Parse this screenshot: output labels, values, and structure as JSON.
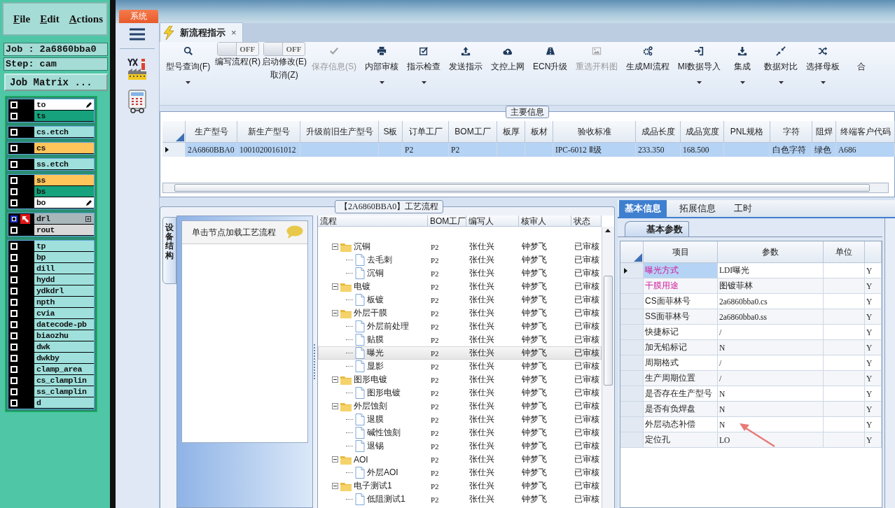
{
  "cam": {
    "menu": [
      "File",
      "Edit",
      "Actions"
    ],
    "job": "Job : 2a6860bba0",
    "step": "Step: cam",
    "matrix_button": "Job Matrix ...",
    "layer_groups": [
      {
        "layers": [
          {
            "name": "to",
            "color": "#ffffff",
            "work_layer": false,
            "pen_mark": true,
            "expandable": false
          },
          {
            "name": "ts",
            "color": "#16a27c",
            "work_layer": false,
            "pen_mark": false,
            "expandable": false
          }
        ]
      },
      {
        "layers": [
          {
            "name": "cs.etch",
            "color": "#9fe0dc",
            "work_layer": false,
            "pen_mark": false,
            "expandable": false
          }
        ]
      },
      {
        "layers": [
          {
            "name": "cs",
            "color": "#ffc45a",
            "work_layer": false,
            "pen_mark": false,
            "expandable": false
          }
        ]
      },
      {
        "layers": [
          {
            "name": "ss.etch",
            "color": "#9fe0dc",
            "work_layer": false,
            "pen_mark": false,
            "expandable": false
          }
        ]
      },
      {
        "layers": [
          {
            "name": "ss",
            "color": "#ffc45a",
            "work_layer": false,
            "pen_mark": false,
            "expandable": false
          },
          {
            "name": "bs",
            "color": "#16a27c",
            "work_layer": false,
            "pen_mark": false,
            "expandable": false
          },
          {
            "name": "bo",
            "color": "#ffffff",
            "work_layer": false,
            "pen_mark": true,
            "expandable": false
          }
        ]
      },
      {
        "layers": [
          {
            "name": "drl",
            "color": "#a9b6ba",
            "work_layer": true,
            "pen_mark": false,
            "expandable": true
          },
          {
            "name": "rout",
            "color": "#d9d9d9",
            "work_layer": false,
            "pen_mark": false,
            "expandable": false
          }
        ]
      },
      {
        "layers": [
          {
            "name": "tp",
            "color": "#9fe0dc",
            "work_layer": false,
            "pen_mark": false,
            "expandable": false
          },
          {
            "name": "bp",
            "color": "#9fe0dc",
            "work_layer": false,
            "pen_mark": false,
            "expandable": false
          },
          {
            "name": "dill",
            "color": "#9fe0dc",
            "work_layer": false,
            "pen_mark": false,
            "expandable": false
          },
          {
            "name": "hydd",
            "color": "#9fe0dc",
            "work_layer": false,
            "pen_mark": false,
            "expandable": false
          },
          {
            "name": "ydkdrl",
            "color": "#9fe0dc",
            "work_layer": false,
            "pen_mark": false,
            "expandable": false
          },
          {
            "name": "npth",
            "color": "#9fe0dc",
            "work_layer": false,
            "pen_mark": false,
            "expandable": false
          },
          {
            "name": "cvia",
            "color": "#9fe0dc",
            "work_layer": false,
            "pen_mark": false,
            "expandable": false
          },
          {
            "name": "datecode-pb",
            "color": "#9fe0dc",
            "work_layer": false,
            "pen_mark": false,
            "expandable": false
          },
          {
            "name": "biaozhu",
            "color": "#9fe0dc",
            "work_layer": false,
            "pen_mark": false,
            "expandable": false
          },
          {
            "name": "dwk",
            "color": "#9fe0dc",
            "work_layer": false,
            "pen_mark": false,
            "expandable": false
          },
          {
            "name": "dwkby",
            "color": "#9fe0dc",
            "work_layer": false,
            "pen_mark": false,
            "expandable": false
          },
          {
            "name": "clamp_area",
            "color": "#9fe0dc",
            "work_layer": false,
            "pen_mark": false,
            "expandable": false
          },
          {
            "name": "cs_clamplin",
            "color": "#9fe0dc",
            "work_layer": false,
            "pen_mark": false,
            "expandable": false
          },
          {
            "name": "ss_clamplin",
            "color": "#9fe0dc",
            "work_layer": false,
            "pen_mark": false,
            "expandable": false
          },
          {
            "name": "d",
            "color": "#9fe0dc",
            "work_layer": false,
            "pen_mark": false,
            "expandable": false
          }
        ]
      }
    ]
  },
  "app": {
    "system_tab": "系统",
    "doc_tab": {
      "title": "新流程指示",
      "close": "×",
      "selected": true
    },
    "toolbar": [
      {
        "kind": "button",
        "label": "型号查询(F)",
        "disabled": false,
        "dropdown": true
      },
      {
        "kind": "toggle",
        "label": "编写流程(R)",
        "state": "OFF",
        "on": false
      },
      {
        "kind": "toggle",
        "label": "启动修改(E)",
        "sublabel": "取消(Z)",
        "state": "OFF",
        "on": false
      },
      {
        "kind": "button",
        "label": "保存信息(S)",
        "disabled": true,
        "dropdown": false
      },
      {
        "kind": "button",
        "label": "内部审核",
        "disabled": false,
        "dropdown": true
      },
      {
        "kind": "button",
        "label": "指示检查",
        "disabled": false,
        "dropdown": true
      },
      {
        "kind": "button",
        "label": "发送指示",
        "disabled": false,
        "dropdown": false
      },
      {
        "kind": "button",
        "label": "文控上网",
        "disabled": false,
        "dropdown": false
      },
      {
        "kind": "button",
        "label": "ECN升级",
        "disabled": false,
        "dropdown": false
      },
      {
        "kind": "button",
        "label": "重选开料图",
        "disabled": true,
        "dropdown": false
      },
      {
        "kind": "button",
        "label": "生成MI流程",
        "disabled": false,
        "dropdown": false
      },
      {
        "kind": "button",
        "label": "MI数据导入",
        "disabled": false,
        "dropdown": true
      },
      {
        "kind": "button",
        "label": "集成",
        "disabled": false,
        "dropdown": true
      },
      {
        "kind": "button",
        "label": "数据对比",
        "disabled": false,
        "dropdown": true
      },
      {
        "kind": "button",
        "label": "选择母板",
        "disabled": false,
        "dropdown": true
      },
      {
        "kind": "button",
        "label": "合",
        "disabled": false,
        "dropdown": false
      }
    ],
    "main_info": {
      "title": "主要信息",
      "columns": [
        "生产型号",
        "新生产型号",
        "升级前旧生产型号",
        "S板",
        "订单工厂",
        "BOM工厂",
        "板厚",
        "板材",
        "验收标准",
        "成品长度",
        "成品宽度",
        "PNL规格",
        "字符",
        "阻焊",
        "终端客户代码"
      ],
      "rows": [
        {
          "selected": true,
          "cells": [
            "2A6860BBA0",
            "10010200161012",
            null,
            null,
            "P2",
            "P2",
            null,
            null,
            "IPC-6012 Ⅱ级",
            "233.350",
            "168.500",
            null,
            "白色字符",
            "绿色",
            "A686"
          ]
        }
      ]
    },
    "process": {
      "title": "【2A6860BBA0】工艺流程",
      "side_tab": "设备结构",
      "hint": "单击节点加载工艺流程",
      "columns": [
        "流程",
        "BOM工厂",
        "编写人",
        "核审人",
        "状态"
      ],
      "tree": [
        {
          "name": "沉铜",
          "bom": "P2",
          "writer": "张仕兴",
          "reviewer": "钟梦飞",
          "status": "已审核",
          "selected": false,
          "expanded": true,
          "children": [
            {
              "name": "去毛刺",
              "bom": "P2",
              "writer": "张仕兴",
              "reviewer": "钟梦飞",
              "status": "已审核",
              "selected": false
            },
            {
              "name": "沉铜",
              "bom": "P2",
              "writer": "张仕兴",
              "reviewer": "钟梦飞",
              "status": "已审核",
              "selected": false
            }
          ]
        },
        {
          "name": "电镀",
          "bom": "P2",
          "writer": "张仕兴",
          "reviewer": "钟梦飞",
          "status": "已审核",
          "selected": false,
          "expanded": true,
          "children": [
            {
              "name": "板镀",
              "bom": "P2",
              "writer": "张仕兴",
              "reviewer": "钟梦飞",
              "status": "已审核",
              "selected": false
            }
          ]
        },
        {
          "name": "外层干膜",
          "bom": "P2",
          "writer": "张仕兴",
          "reviewer": "钟梦飞",
          "status": "已审核",
          "selected": false,
          "expanded": true,
          "children": [
            {
              "name": "外层前处理",
              "bom": "P2",
              "writer": "张仕兴",
              "reviewer": "钟梦飞",
              "status": "已审核",
              "selected": false
            },
            {
              "name": "贴膜",
              "bom": "P2",
              "writer": "张仕兴",
              "reviewer": "钟梦飞",
              "status": "已审核",
              "selected": false
            },
            {
              "name": "曝光",
              "bom": "P2",
              "writer": "张仕兴",
              "reviewer": "钟梦飞",
              "status": "已审核",
              "selected": true
            },
            {
              "name": "显影",
              "bom": "P2",
              "writer": "张仕兴",
              "reviewer": "钟梦飞",
              "status": "已审核",
              "selected": false
            }
          ]
        },
        {
          "name": "图形电镀",
          "bom": "P2",
          "writer": "张仕兴",
          "reviewer": "钟梦飞",
          "status": "已审核",
          "selected": false,
          "expanded": true,
          "children": [
            {
              "name": "图形电镀",
              "bom": "P2",
              "writer": "张仕兴",
              "reviewer": "钟梦飞",
              "status": "已审核",
              "selected": false
            }
          ]
        },
        {
          "name": "外层蚀刻",
          "bom": "P2",
          "writer": "张仕兴",
          "reviewer": "钟梦飞",
          "status": "已审核",
          "selected": false,
          "expanded": true,
          "children": [
            {
              "name": "退膜",
              "bom": "P2",
              "writer": "张仕兴",
              "reviewer": "钟梦飞",
              "status": "已审核",
              "selected": false
            },
            {
              "name": "碱性蚀刻",
              "bom": "P2",
              "writer": "张仕兴",
              "reviewer": "钟梦飞",
              "status": "已审核",
              "selected": false
            },
            {
              "name": "退锡",
              "bom": "P2",
              "writer": "张仕兴",
              "reviewer": "钟梦飞",
              "status": "已审核",
              "selected": false
            }
          ]
        },
        {
          "name": "AOI",
          "bom": "P2",
          "writer": "张仕兴",
          "reviewer": "钟梦飞",
          "status": "已审核",
          "selected": false,
          "expanded": true,
          "children": [
            {
              "name": "外层AOI",
              "bom": "P2",
              "writer": "张仕兴",
              "reviewer": "钟梦飞",
              "status": "已审核",
              "selected": false
            }
          ]
        },
        {
          "name": "电子测试1",
          "bom": "P2",
          "writer": "张仕兴",
          "reviewer": "钟梦飞",
          "status": "已审核",
          "selected": false,
          "expanded": true,
          "children": [
            {
              "name": "低阻测试1",
              "bom": "P2",
              "writer": "张仕兴",
              "reviewer": "钟梦飞",
              "status": "已审核",
              "selected": false
            }
          ]
        }
      ]
    },
    "params": {
      "tabs": [
        {
          "label": "基本信息",
          "selected": true
        },
        {
          "label": "拓展信息",
          "selected": false
        },
        {
          "label": "工时",
          "selected": false
        }
      ],
      "subtab": "基本参数",
      "columns": [
        "项目",
        "参数",
        "单位"
      ],
      "rows": [
        {
          "item": "曝光方式",
          "value": "LDI曝光",
          "column_4": "Y",
          "required": true,
          "selected": true
        },
        {
          "item": "干膜用途",
          "value": "图镀菲林",
          "column_4": "Y",
          "required": true,
          "selected": false
        },
        {
          "item": "CS面菲林号",
          "value": "2a6860bba0.cs",
          "column_4": "Y",
          "required": false,
          "selected": false
        },
        {
          "item": "SS面菲林号",
          "value": "2a6860bba0.ss",
          "column_4": "Y",
          "required": false,
          "selected": false
        },
        {
          "item": "快捷标记",
          "value": "/",
          "column_4": "Y",
          "required": false,
          "selected": false
        },
        {
          "item": "加无铅标记",
          "value": "N",
          "column_4": "Y",
          "required": false,
          "selected": false
        },
        {
          "item": "周期格式",
          "value": "/",
          "column_4": "Y",
          "required": false,
          "selected": false
        },
        {
          "item": "生产周期位置",
          "value": "/",
          "column_4": "Y",
          "required": false,
          "selected": false
        },
        {
          "item": "是否存在生产型号",
          "value": "N",
          "column_4": "Y",
          "required": false,
          "selected": false
        },
        {
          "item": "是否有负焊盘",
          "value": "N",
          "column_4": "Y",
          "required": false,
          "selected": false
        },
        {
          "item": "外层动态补偿",
          "value": "N",
          "column_4": "Y",
          "required": false,
          "selected": false
        },
        {
          "item": "定位孔",
          "value": "LO",
          "column_4": "Y",
          "required": false,
          "selected": false
        }
      ]
    }
  }
}
